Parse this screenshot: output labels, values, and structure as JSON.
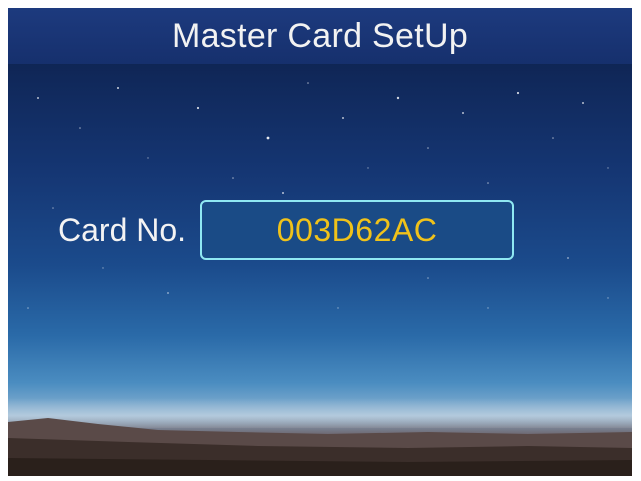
{
  "header": {
    "title": "Master Card SetUp"
  },
  "form": {
    "card_label": "Card No.",
    "card_value": "003D62AC"
  },
  "colors": {
    "title_bar": "#1a357a",
    "label_text": "#f3f3f3",
    "value_text": "#f0c21a",
    "field_border": "#8fe8f2",
    "field_background": "#1a4b86"
  }
}
